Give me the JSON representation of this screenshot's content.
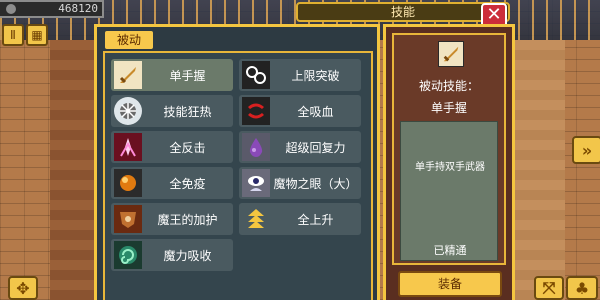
{
  "hud": {
    "gold": "468120",
    "gold_icon": "coin-icon"
  },
  "header": {
    "title": "技能",
    "close_label": "✕"
  },
  "panel": {
    "tab_label": "被动"
  },
  "skills": [
    {
      "label": "单手握",
      "icon": "sword-icon",
      "bg": "#f1e4c2"
    },
    {
      "label": "上限突破",
      "icon": "chain-break-icon",
      "bg": "#222222"
    },
    {
      "label": "技能狂热",
      "icon": "burst-icon",
      "bg": "#dfe6ea"
    },
    {
      "label": "全吸血",
      "icon": "fang-icon",
      "bg": "#222222"
    },
    {
      "label": "全反击",
      "icon": "counter-icon",
      "bg": "#6a1020"
    },
    {
      "label": "超级回复力",
      "icon": "potion-icon",
      "bg": "#5a5a6a"
    },
    {
      "label": "全免疫",
      "icon": "orb-icon",
      "bg": "#2b2b2b"
    },
    {
      "label": "魔物之眼（大）",
      "icon": "eye-icon",
      "bg": "#6a6a7a"
    },
    {
      "label": "魔王的加护",
      "icon": "demon-shield-icon",
      "bg": "#6a2a10"
    },
    {
      "label": "全上升",
      "icon": "triple-arrow-up-icon",
      "bg": "#4a5a60"
    },
    {
      "label": "魔力吸收",
      "icon": "swirl-icon",
      "bg": "#1b3b30"
    }
  ],
  "detail": {
    "type_label": "被动技能：",
    "name": "单手握",
    "description": "单手持双手武器",
    "status": "已精通",
    "equip_label": "装备"
  },
  "side_controls": {
    "left_top_a": "pause-icon",
    "left_top_b": "grid-icon",
    "right_mid": "double-chevron-right-icon",
    "bottom_left": "dpad-icon",
    "bottom_right_a": "arrows-icon",
    "bottom_right_b": "tree-icon"
  },
  "colors": {
    "accent_gold": "#f4c640",
    "panel_bg": "#2d3a42",
    "detail_bg": "#5a2e20",
    "close_red": "#cc2d3a"
  }
}
